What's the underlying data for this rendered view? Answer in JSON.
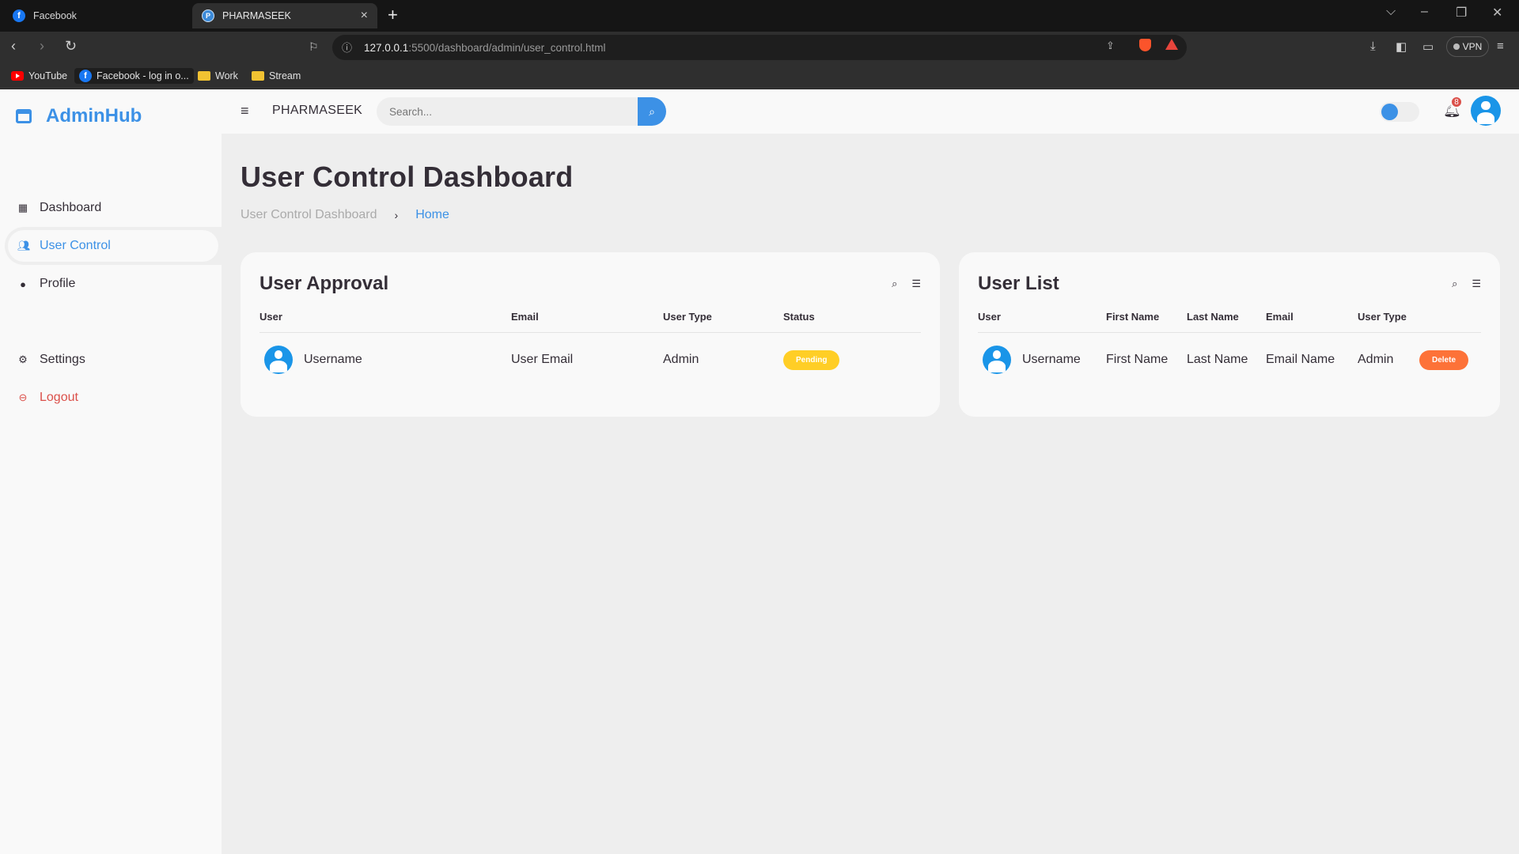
{
  "browser": {
    "tabs": [
      {
        "title": "Facebook"
      },
      {
        "title": "PHARMASEEK"
      }
    ],
    "url_host": "127.0.0.1",
    "url_rest": ":5500/dashboard/admin/user_control.html",
    "vpn_label": "VPN",
    "bookmarks": [
      "YouTube",
      "Facebook - log in o...",
      "Work",
      "Stream"
    ]
  },
  "sidebar": {
    "brand": "AdminHub",
    "items": [
      {
        "label": "Dashboard",
        "icon": "dashboard-icon"
      },
      {
        "label": "User Control",
        "icon": "users-icon"
      },
      {
        "label": "Profile",
        "icon": "profile-icon"
      }
    ],
    "bottom_items": [
      {
        "label": "Settings",
        "icon": "gear-icon"
      },
      {
        "label": "Logout",
        "icon": "logout-icon"
      }
    ]
  },
  "topnav": {
    "title": "PHARMASEEK",
    "search_placeholder": "Search...",
    "notification_count": "8"
  },
  "main": {
    "title": "User Control Dashboard",
    "breadcrumb": [
      "User Control Dashboard",
      "Home"
    ]
  },
  "approval": {
    "title": "User Approval",
    "columns": [
      "User",
      "Email",
      "User Type",
      "Status"
    ],
    "rows": [
      {
        "user": "Username",
        "email": "User Email",
        "type": "Admin",
        "status": "Pending"
      }
    ]
  },
  "user_list": {
    "title": "User List",
    "columns": [
      "User",
      "First Name",
      "Last Name",
      "Email",
      "User Type"
    ],
    "rows": [
      {
        "user": "Username",
        "first": "First Name",
        "last": "Last Name",
        "email": "Email Name",
        "type": "Admin",
        "action": "Delete"
      }
    ]
  },
  "colors": {
    "accent": "#3c91e6",
    "pending": "#ffce26",
    "delete": "#fd7238",
    "danger": "#db504a"
  }
}
